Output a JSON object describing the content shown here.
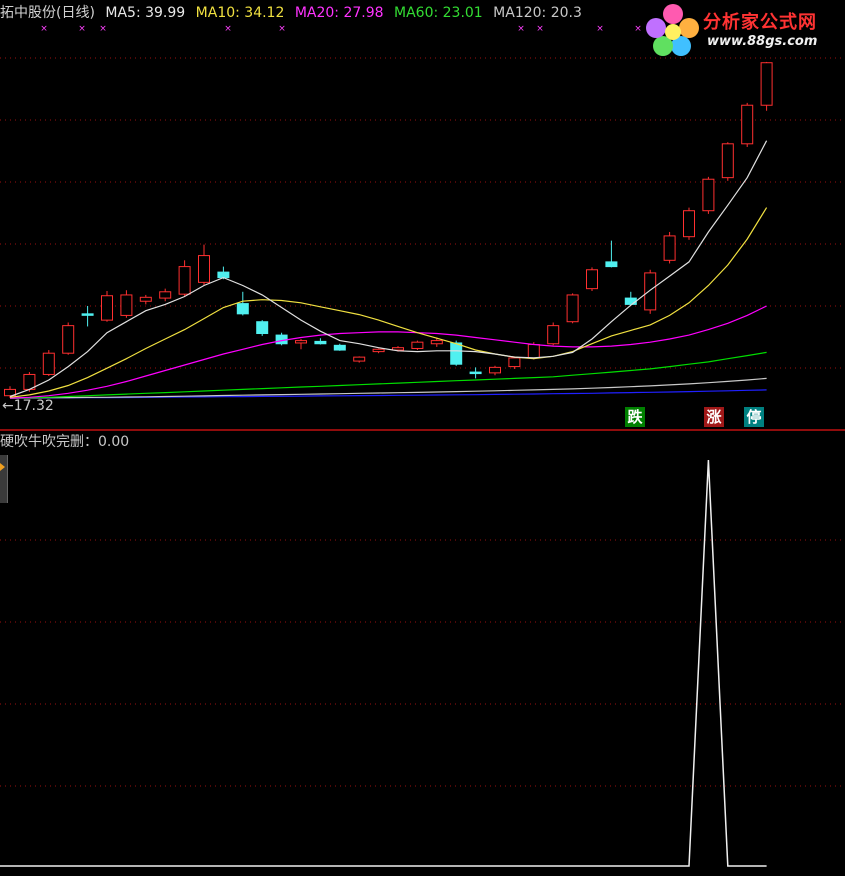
{
  "header": {
    "stock": "拓中股份(日线)",
    "ma5": "MA5: 39.99",
    "ma10": "MA10: 34.12",
    "ma20": "MA20: 27.98",
    "ma60": "MA60: 23.01",
    "ma120": "MA120: 20.3"
  },
  "colors": {
    "ma5": "#e0e0e0",
    "ma10": "#f0e040",
    "ma20": "#ff00ff",
    "ma60": "#00dd00",
    "ma120": "#c8c8c8",
    "up": "#ff3030",
    "down": "#50f0f0",
    "grid": "#9a1010"
  },
  "logo": {
    "name": "分析家公式网",
    "url": "www.88gs.com"
  },
  "price_min_label": "←17.32",
  "signals": [
    {
      "label": "跌",
      "color": "#008000"
    },
    {
      "label": "涨",
      "color": "#a01818"
    },
    {
      "label": "停",
      "color": "#008080"
    }
  ],
  "indicator": {
    "title": "硬吹牛吹完删：0.00"
  },
  "chart_data": {
    "type": "line",
    "series": [
      {
        "values": [
          0,
          0,
          0,
          0,
          0,
          0,
          0,
          0,
          0,
          0,
          0,
          0,
          0,
          0,
          0,
          0,
          0,
          0,
          0,
          0,
          0,
          0,
          0,
          0,
          0,
          0,
          0,
          0,
          0,
          0,
          0,
          0,
          0,
          0,
          0,
          0,
          1,
          0,
          0,
          0
        ]
      }
    ]
  },
  "candles": [
    {
      "o": 17.6,
      "h": 18.8,
      "l": 17.32,
      "c": 18.4,
      "up": true
    },
    {
      "o": 18.4,
      "h": 20.6,
      "l": 18.1,
      "c": 20.3,
      "up": true
    },
    {
      "o": 20.3,
      "h": 23.4,
      "l": 20.1,
      "c": 23.0,
      "up": true
    },
    {
      "o": 23.0,
      "h": 26.9,
      "l": 22.8,
      "c": 26.5,
      "up": true
    },
    {
      "o": 28.0,
      "h": 29.0,
      "l": 26.4,
      "c": 28.0,
      "up": false
    },
    {
      "o": 27.2,
      "h": 30.9,
      "l": 27.0,
      "c": 30.3,
      "up": true
    },
    {
      "o": 27.8,
      "h": 31.0,
      "l": 27.5,
      "c": 30.4,
      "up": true
    },
    {
      "o": 29.6,
      "h": 30.4,
      "l": 29.2,
      "c": 30.1,
      "up": true
    },
    {
      "o": 30.0,
      "h": 31.2,
      "l": 29.6,
      "c": 30.8,
      "up": true
    },
    {
      "o": 30.5,
      "h": 34.8,
      "l": 30.2,
      "c": 34.0,
      "up": true
    },
    {
      "o": 32.0,
      "h": 36.8,
      "l": 31.6,
      "c": 35.4,
      "up": true
    },
    {
      "o": 33.3,
      "h": 34.0,
      "l": 32.4,
      "c": 32.6,
      "up": false
    },
    {
      "o": 29.3,
      "h": 30.8,
      "l": 27.8,
      "c": 28.0,
      "up": false
    },
    {
      "o": 27.0,
      "h": 27.2,
      "l": 25.2,
      "c": 25.5,
      "up": false
    },
    {
      "o": 25.3,
      "h": 25.6,
      "l": 24.0,
      "c": 24.2,
      "up": false
    },
    {
      "o": 24.3,
      "h": 24.8,
      "l": 23.5,
      "c": 24.6,
      "up": true
    },
    {
      "o": 24.5,
      "h": 24.9,
      "l": 24.1,
      "c": 24.2,
      "up": false
    },
    {
      "o": 24.0,
      "h": 24.2,
      "l": 23.3,
      "c": 23.4,
      "up": false
    },
    {
      "o": 22.0,
      "h": 22.6,
      "l": 21.8,
      "c": 22.5,
      "up": true
    },
    {
      "o": 23.2,
      "h": 23.6,
      "l": 23.0,
      "c": 23.5,
      "up": true
    },
    {
      "o": 23.4,
      "h": 23.9,
      "l": 23.2,
      "c": 23.7,
      "up": true
    },
    {
      "o": 23.6,
      "h": 24.6,
      "l": 23.4,
      "c": 24.4,
      "up": true
    },
    {
      "o": 24.2,
      "h": 25.0,
      "l": 23.8,
      "c": 24.6,
      "up": true
    },
    {
      "o": 24.3,
      "h": 24.6,
      "l": 21.4,
      "c": 21.6,
      "up": false
    },
    {
      "o": 20.6,
      "h": 21.2,
      "l": 19.8,
      "c": 20.5,
      "up": false
    },
    {
      "o": 20.5,
      "h": 21.4,
      "l": 20.2,
      "c": 21.2,
      "up": true
    },
    {
      "o": 21.3,
      "h": 22.6,
      "l": 21.0,
      "c": 22.4,
      "up": true
    },
    {
      "o": 22.4,
      "h": 24.4,
      "l": 22.2,
      "c": 24.1,
      "up": true
    },
    {
      "o": 24.2,
      "h": 26.9,
      "l": 24.0,
      "c": 26.5,
      "up": true
    },
    {
      "o": 27.0,
      "h": 30.6,
      "l": 26.8,
      "c": 30.4,
      "up": true
    },
    {
      "o": 31.2,
      "h": 33.9,
      "l": 30.9,
      "c": 33.6,
      "up": true
    },
    {
      "o": 34.6,
      "h": 37.3,
      "l": 33.9,
      "c": 34.0,
      "up": false
    },
    {
      "o": 30.0,
      "h": 30.8,
      "l": 29.1,
      "c": 29.2,
      "up": false
    },
    {
      "o": 28.5,
      "h": 33.6,
      "l": 28.0,
      "c": 33.2,
      "up": true
    },
    {
      "o": 34.8,
      "h": 38.4,
      "l": 34.4,
      "c": 37.9,
      "up": true
    },
    {
      "o": 37.8,
      "h": 41.5,
      "l": 37.4,
      "c": 41.1,
      "up": true
    },
    {
      "o": 41.1,
      "h": 45.4,
      "l": 40.7,
      "c": 45.1,
      "up": true
    },
    {
      "o": 45.3,
      "h": 49.8,
      "l": 44.9,
      "c": 49.6,
      "up": true
    },
    {
      "o": 49.6,
      "h": 54.8,
      "l": 49.2,
      "c": 54.5,
      "up": true
    },
    {
      "o": 54.5,
      "h": 60.0,
      "l": 53.8,
      "c": 59.9,
      "up": true
    }
  ],
  "ma": {
    "ma5": [
      17.5,
      18.4,
      19.6,
      21.3,
      23.2,
      25.6,
      27.0,
      28.4,
      29.2,
      30.2,
      31.6,
      32.6,
      31.6,
      30.4,
      28.8,
      27.2,
      25.8,
      24.6,
      24.2,
      23.7,
      23.3,
      23.2,
      23.3,
      23.3,
      23.2,
      22.9,
      22.5,
      22.4,
      22.6,
      23.1,
      24.8,
      27.0,
      29.1,
      31.0,
      32.8,
      34.6,
      38.4,
      41.8,
      45.3,
      50.0
    ],
    "ma10": [
      17.4,
      17.7,
      18.2,
      18.9,
      19.9,
      21.1,
      22.3,
      23.6,
      24.8,
      26.0,
      27.4,
      28.8,
      29.6,
      29.8,
      29.7,
      29.4,
      28.9,
      28.4,
      27.9,
      27.2,
      26.4,
      25.6,
      24.9,
      24.2,
      23.4,
      22.9,
      22.5,
      22.3,
      22.6,
      23.2,
      24.2,
      25.2,
      25.9,
      26.6,
      27.8,
      29.4,
      31.6,
      34.2,
      37.5,
      41.5
    ],
    "ma20": [
      17.3,
      17.4,
      17.6,
      17.9,
      18.3,
      18.8,
      19.4,
      20.1,
      20.8,
      21.5,
      22.2,
      22.9,
      23.5,
      24.1,
      24.6,
      25.0,
      25.3,
      25.5,
      25.6,
      25.7,
      25.7,
      25.6,
      25.5,
      25.3,
      25.0,
      24.7,
      24.4,
      24.1,
      23.9,
      23.8,
      23.8,
      23.9,
      24.1,
      24.4,
      24.8,
      25.3,
      26.0,
      26.8,
      27.8,
      29.0
    ],
    "ma60": [
      17.3,
      17.35,
      17.4,
      17.5,
      17.6,
      17.7,
      17.8,
      17.9,
      18.0,
      18.1,
      18.2,
      18.3,
      18.4,
      18.5,
      18.6,
      18.7,
      18.8,
      18.9,
      19.0,
      19.1,
      19.2,
      19.3,
      19.4,
      19.5,
      19.6,
      19.7,
      19.8,
      19.9,
      20.0,
      20.2,
      20.4,
      20.6,
      20.8,
      21.0,
      21.3,
      21.6,
      21.9,
      22.3,
      22.7,
      23.1
    ],
    "ma120": [
      17.3,
      17.32,
      17.34,
      17.36,
      17.38,
      17.4,
      17.43,
      17.46,
      17.5,
      17.54,
      17.58,
      17.62,
      17.66,
      17.7,
      17.74,
      17.78,
      17.82,
      17.86,
      17.9,
      17.94,
      17.98,
      18.02,
      18.07,
      18.12,
      18.17,
      18.22,
      18.28,
      18.34,
      18.4,
      18.47,
      18.55,
      18.64,
      18.74,
      18.85,
      18.97,
      19.1,
      19.25,
      19.42,
      19.6,
      19.8
    ],
    "mabase": [
      17.3,
      17.31,
      17.32,
      17.33,
      17.34,
      17.35,
      17.37,
      17.39,
      17.41,
      17.43,
      17.45,
      17.47,
      17.49,
      17.51,
      17.53,
      17.55,
      17.57,
      17.59,
      17.61,
      17.63,
      17.65,
      17.67,
      17.69,
      17.71,
      17.73,
      17.76,
      17.79,
      17.82,
      17.85,
      17.88,
      17.91,
      17.95,
      17.99,
      18.03,
      18.07,
      18.12,
      18.17,
      18.22,
      18.28,
      18.34
    ]
  }
}
